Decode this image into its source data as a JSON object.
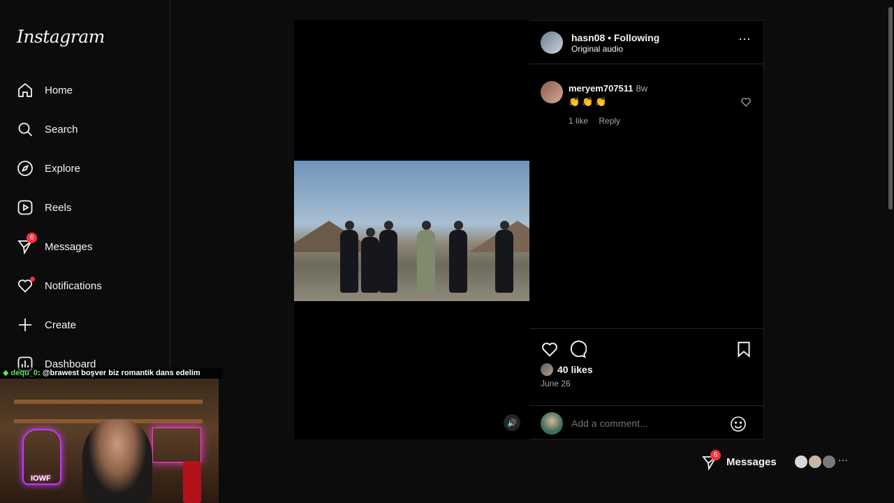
{
  "app": {
    "logo": "Instagram"
  },
  "sidebar": {
    "items": [
      {
        "label": "Home",
        "icon": "home-icon"
      },
      {
        "label": "Search",
        "icon": "search-icon"
      },
      {
        "label": "Explore",
        "icon": "compass-icon"
      },
      {
        "label": "Reels",
        "icon": "reels-icon"
      },
      {
        "label": "Messages",
        "icon": "messenger-icon",
        "badge": "6"
      },
      {
        "label": "Notifications",
        "icon": "heart-icon",
        "dot": true
      },
      {
        "label": "Create",
        "icon": "plus-icon"
      },
      {
        "label": "Dashboard",
        "icon": "dashboard-icon"
      }
    ]
  },
  "stream_overlay": {
    "chat_user": "dequ_0",
    "chat_message": ": @brawest boşver biz romantik dans edelim",
    "cam_sign": "IOWF"
  },
  "post": {
    "username": "hasn08",
    "separator": "•",
    "follow_status": "Following",
    "audio": "Original audio",
    "likes": "40 likes",
    "date": "June 26",
    "comment_placeholder": "Add a comment..."
  },
  "comments": [
    {
      "username": "meryem707511",
      "time": "8w",
      "text": "👏👏👏",
      "likes": "1 like",
      "reply_label": "Reply"
    }
  ],
  "bottom_messages": {
    "label": "Messages",
    "badge": "6",
    "more": "···"
  },
  "colors": {
    "badge": "#ff3040",
    "background": "#000000",
    "muted": "#a8a8a8"
  }
}
